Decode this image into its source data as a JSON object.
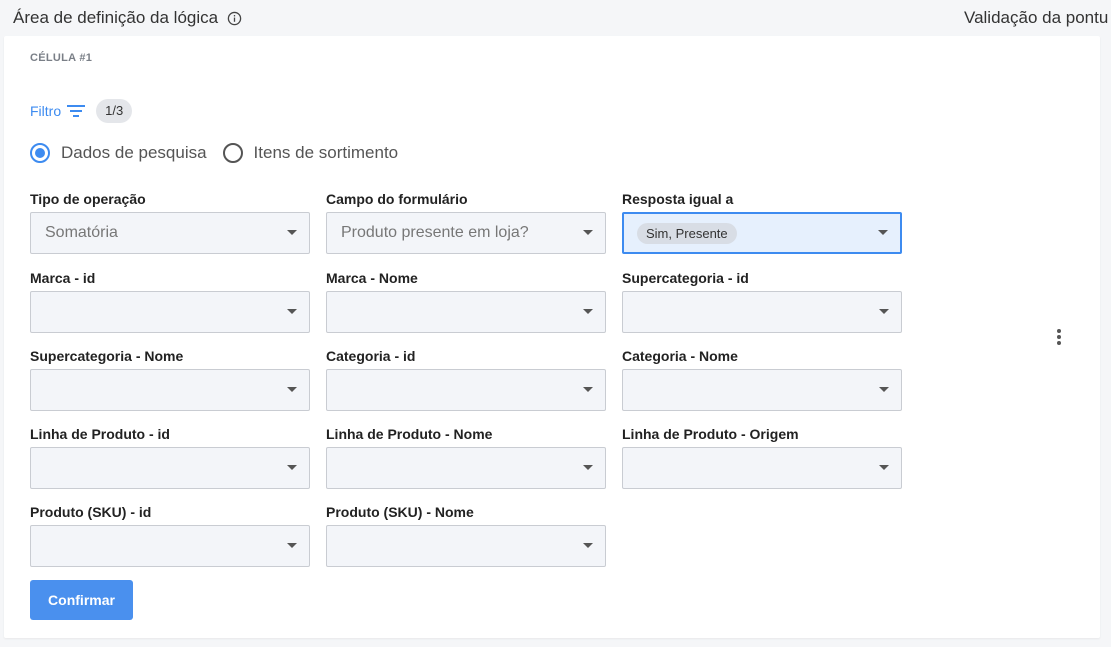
{
  "header": {
    "title": "Área de definição da lógica",
    "right_title": "Validação da pontu"
  },
  "cell": {
    "label": "CÉLULA #1"
  },
  "filter": {
    "label": "Filtro",
    "badge": "1/3"
  },
  "source_options": [
    {
      "label": "Dados de pesquisa",
      "selected": true
    },
    {
      "label": "Itens de sortimento",
      "selected": false
    }
  ],
  "fields": {
    "tipo_operacao": {
      "label": "Tipo de operação",
      "value": "Somatória"
    },
    "campo_formulario": {
      "label": "Campo do formulário",
      "value": "Produto presente em loja?"
    },
    "resposta_igual": {
      "label": "Resposta igual a",
      "chip": "Sim, Presente"
    },
    "marca_id": {
      "label": "Marca - id",
      "value": ""
    },
    "marca_nome": {
      "label": "Marca - Nome",
      "value": ""
    },
    "supercategoria_id": {
      "label": "Supercategoria - id",
      "value": ""
    },
    "supercategoria_nome": {
      "label": "Supercategoria - Nome",
      "value": ""
    },
    "categoria_id": {
      "label": "Categoria - id",
      "value": ""
    },
    "categoria_nome": {
      "label": "Categoria - Nome",
      "value": ""
    },
    "linha_produto_id": {
      "label": "Linha de Produto - id",
      "value": ""
    },
    "linha_produto_nome": {
      "label": "Linha de Produto - Nome",
      "value": ""
    },
    "linha_produto_origem": {
      "label": "Linha de Produto - Origem",
      "value": ""
    },
    "produto_sku_id": {
      "label": "Produto (SKU) - id",
      "value": ""
    },
    "produto_sku_nome": {
      "label": "Produto (SKU) - Nome",
      "value": ""
    }
  },
  "actions": {
    "confirm_label": "Confirmar"
  },
  "colors": {
    "accent": "#3d8bf0",
    "button": "#4a90ee",
    "field_bg": "#f3f5f9"
  },
  "icons": {
    "info": "info-icon",
    "filter": "filter-lines-icon",
    "dropdown": "chevron-down-icon",
    "more": "kebab-menu-icon"
  }
}
